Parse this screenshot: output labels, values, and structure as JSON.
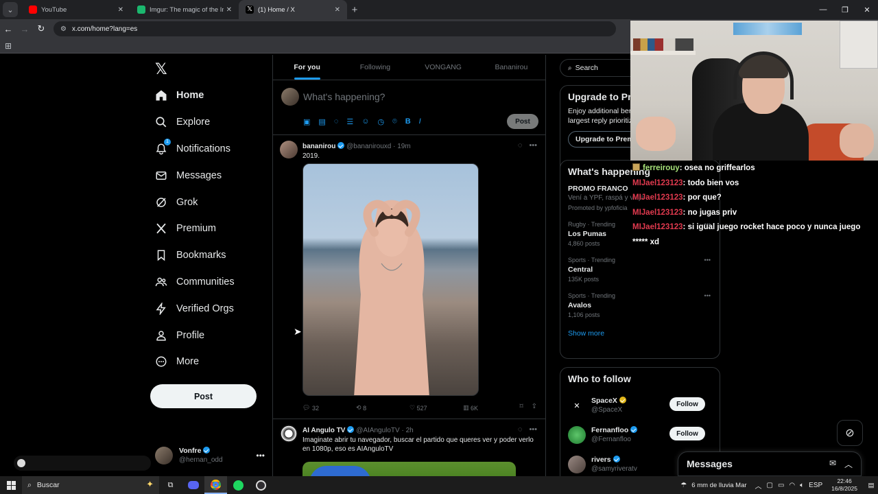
{
  "browser": {
    "tabs": [
      {
        "title": "YouTube",
        "color": "#ff0000",
        "active": false
      },
      {
        "title": "Imgur: The magic of the Internet",
        "color": "#1bb76e",
        "active": false
      },
      {
        "title": "(1) Home / X",
        "color": "#000000",
        "active": true
      }
    ],
    "url": "x.com/home?lang=es"
  },
  "left_nav": {
    "items": [
      {
        "label": "Home",
        "icon": "home-icon"
      },
      {
        "label": "Explore",
        "icon": "search-icon"
      },
      {
        "label": "Notifications",
        "icon": "bell-icon",
        "badge": "1"
      },
      {
        "label": "Messages",
        "icon": "envelope-icon"
      },
      {
        "label": "Grok",
        "icon": "grok-icon"
      },
      {
        "label": "Premium",
        "icon": "x-icon"
      },
      {
        "label": "Bookmarks",
        "icon": "bookmark-icon"
      },
      {
        "label": "Communities",
        "icon": "people-icon"
      },
      {
        "label": "Verified Orgs",
        "icon": "lightning-icon"
      },
      {
        "label": "Profile",
        "icon": "person-icon"
      },
      {
        "label": "More",
        "icon": "more-circle-icon"
      }
    ],
    "post_label": "Post",
    "account": {
      "name": "Vonfre",
      "handle": "@hernan_odd"
    }
  },
  "feed": {
    "tabs": [
      "For you",
      "Following",
      "VONGANG",
      "Bananirou"
    ],
    "composer_placeholder": "What's happening?",
    "composer_post": "Post",
    "tweets": [
      {
        "name": "bananirou",
        "handle": "@bananirouxd",
        "time": "19m",
        "text": "2019.",
        "replies": "32",
        "reposts": "8",
        "likes": "527",
        "views": "6K"
      },
      {
        "name": "AI Angulo TV",
        "handle": "@AIAnguloTV",
        "time": "2h",
        "text": "Imaginate abrir tu navegador, buscar el partido que queres ver y poder verlo en 1080p, eso es AIAnguloTV"
      }
    ]
  },
  "right": {
    "search_placeholder": "Search",
    "premium": {
      "title": "Upgrade to Pr",
      "text_1": "Enjoy additional ber",
      "text_2": "largest reply prioritiz",
      "button": "Upgrade to Prem"
    },
    "trends_title": "What's happening",
    "promo": {
      "title": "PROMO FRANCO",
      "subtitle": "Vení a YPF, raspá y viajá",
      "promoted": "Promoted by ypfoficia"
    },
    "trends": [
      {
        "context": "Rugby · Trending",
        "topic": "Los Pumas",
        "posts": "4,860 posts"
      },
      {
        "context": "Sports · Trending",
        "topic": "Central",
        "posts": "135K posts"
      },
      {
        "context": "Sports · Trending",
        "topic": "Avalos",
        "posts": "1,106 posts"
      }
    ],
    "show_more": "Show more",
    "who_to_follow": "Who to follow",
    "follow_label": "Follow",
    "suggestions": [
      {
        "name": "SpaceX",
        "handle": "@SpaceX"
      },
      {
        "name": "Fernanfloo",
        "handle": "@Fernanfloo"
      },
      {
        "name": "rivers",
        "handle": "@samyriveratv"
      }
    ],
    "messages": "Messages"
  },
  "chat": [
    {
      "user": "ferreirouy",
      "msg": ": osea no griffearlos",
      "user_color": "#a8e37a"
    },
    {
      "user": "MIJael123123",
      "msg": ": todo bien vos",
      "user_color": "#e23a4f"
    },
    {
      "user": "MIJael123123",
      "msg": ": por que?",
      "user_color": "#e23a4f"
    },
    {
      "user": "MIJael123123",
      "msg": ": no jugas priv",
      "user_color": "#e23a4f"
    },
    {
      "user": "MIJael123123",
      "msg": ": si igual juego rocket hace poco y nunca juego",
      "user_color": "#e23a4f"
    },
    {
      "user": "",
      "msg": "***** xd",
      "user_color": "#ffffff"
    }
  ],
  "taskbar": {
    "search": "Buscar",
    "weather": "6 mm de lluvia Mar",
    "lang": "ESP",
    "time": "22:46",
    "date": "16/8/2025"
  }
}
